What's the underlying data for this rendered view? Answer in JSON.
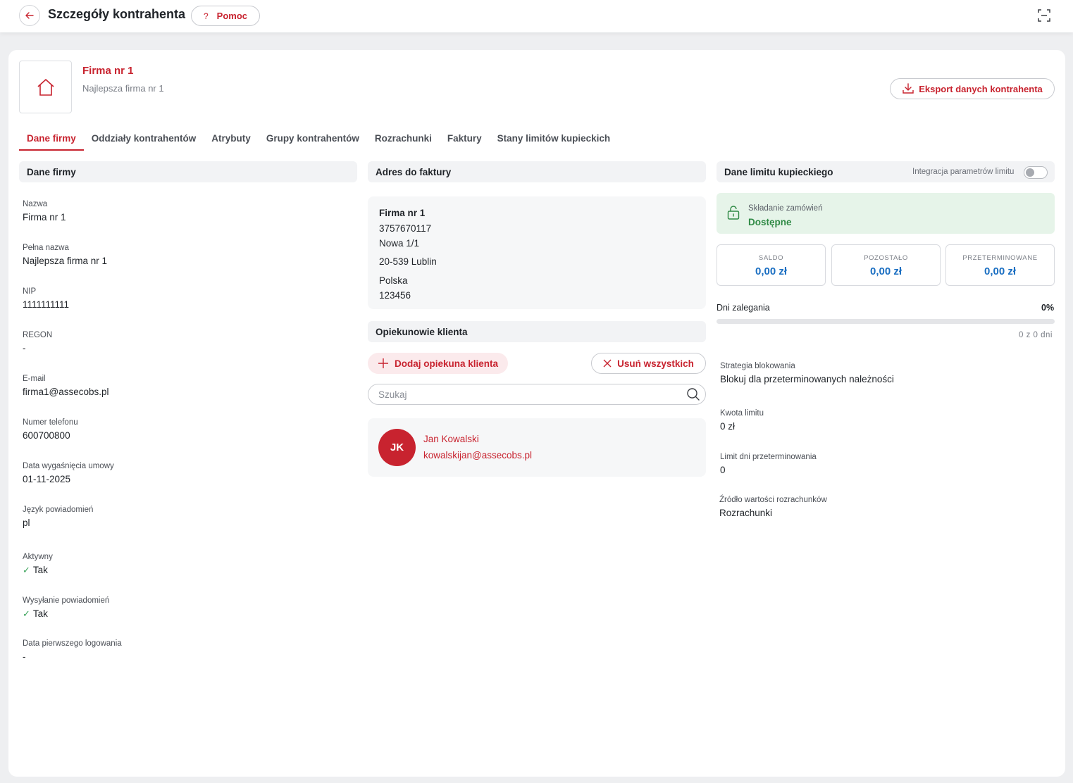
{
  "header": {
    "title": "Szczegóły kontrahenta",
    "help_label": "Pomoc",
    "help_glyph": "?"
  },
  "company": {
    "name": "Firma nr 1",
    "subtitle": "Najlepsza firma nr 1",
    "export_label": "Eksport danych kontrahenta"
  },
  "tabs": [
    {
      "label": "Dane firmy",
      "active": true
    },
    {
      "label": "Oddziały kontrahentów"
    },
    {
      "label": "Atrybuty"
    },
    {
      "label": "Grupy kontrahentów"
    },
    {
      "label": "Rozrachunki"
    },
    {
      "label": "Faktury"
    },
    {
      "label": "Stany limitów kupieckich"
    }
  ],
  "company_data": {
    "heading": "Dane firmy",
    "fields": [
      {
        "label": "Nazwa",
        "value": "Firma nr 1"
      },
      {
        "label": "Pełna nazwa",
        "value": "Najlepsza firma nr 1"
      },
      {
        "label": "NIP",
        "value": "1111111111"
      },
      {
        "label": "REGON",
        "value": "-"
      },
      {
        "label": "E-mail",
        "value": "firma1@assecobs.pl"
      },
      {
        "label": "Numer telefonu",
        "value": "600700800"
      },
      {
        "label": "Data wygaśnięcia umowy",
        "value": "01-11-2025"
      },
      {
        "label": "Język powiadomień",
        "value": "pl"
      },
      {
        "label": "Aktywny",
        "value": "Tak"
      },
      {
        "label": "Wysyłanie powiadomień",
        "value": "Tak"
      },
      {
        "label": "Data pierwszego logowania",
        "value": "-"
      }
    ]
  },
  "invoice_address": {
    "heading": "Adres do faktury",
    "name": "Firma nr 1",
    "tax_id": "3757670117",
    "street": "Nowa 1/1",
    "city": "20-539 Lublin",
    "country": "Polska",
    "number": "123456"
  },
  "guardians": {
    "heading": "Opiekunowie klienta",
    "add_label": "Dodaj opiekuna klienta",
    "remove_all_label": "Usuń wszystkich",
    "search_placeholder": "Szukaj",
    "items": [
      {
        "initials": "JK",
        "name": "Jan Kowalski",
        "email": "kowalskijan@assecobs.pl"
      }
    ]
  },
  "credit_limit": {
    "heading": "Dane limitu kupieckiego",
    "integration_label": "Integracja parametrów limitu",
    "integration_enabled": false,
    "order_status_label": "Składanie zamówień",
    "order_status_value": "Dostępne",
    "stats": [
      {
        "label": "SALDO",
        "value": "0,00 zł"
      },
      {
        "label": "POZOSTAŁO",
        "value": "0,00 zł"
      },
      {
        "label": "PRZETERMINOWANE",
        "value": "0,00 zł"
      }
    ],
    "overdue_days_label": "Dni zalegania",
    "overdue_percent": "0%",
    "overdue_fraction": 0,
    "overdue_count": "0 z 0 dni",
    "fields": [
      {
        "label": "Strategia blokowania",
        "value": "Blokuj dla przeterminowanych należności"
      },
      {
        "label": "Kwota limitu",
        "value": "0 zł"
      },
      {
        "label": "Limit dni przeterminowania",
        "value": "0"
      },
      {
        "label": "Źródło wartości rozrachunków",
        "value": "Rozrachunki"
      }
    ]
  },
  "colors": {
    "accent": "#c8232f",
    "success": "#2f8a45",
    "stat_value": "#1b6fc2"
  }
}
